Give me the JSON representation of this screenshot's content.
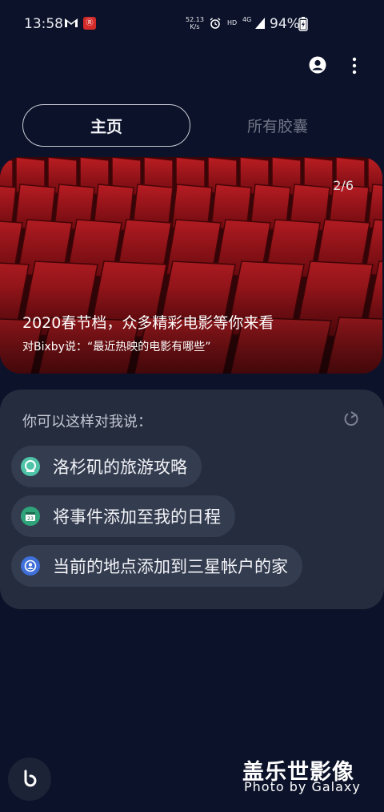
{
  "status_bar": {
    "time": "13:58",
    "app_badge": "Ⓡ",
    "network_speed_value": "52.13",
    "network_speed_unit": "K/s",
    "hd": "HD",
    "network_type": "4G",
    "battery": "94%"
  },
  "tabs": {
    "home": "主页",
    "all_capsules": "所有胶囊"
  },
  "banner": {
    "counter": "2/6",
    "title": "2020春节档，众多精彩电影等你来看",
    "subtitle": "对Bixby说：“最近热映的电影有哪些”"
  },
  "suggestions": {
    "heading": "你可以这样对我说：",
    "items": [
      {
        "label": "洛杉矶的旅游攻略",
        "icon": "travel-icon",
        "color": "#4ec3a8"
      },
      {
        "label": "将事件添加至我的日程",
        "icon": "calendar-icon",
        "color": "#2fa37a"
      },
      {
        "label": "当前的地点添加到三星帐户的家",
        "icon": "account-icon",
        "color": "#3f6fd8"
      }
    ]
  },
  "watermark": {
    "title": "盖乐世影像",
    "subtitle": "Photo by Galaxy"
  },
  "colors": {
    "background": "#0c1229",
    "card": "#252c3d",
    "chip": "#343c4f",
    "seat_red": "#b3141c"
  }
}
